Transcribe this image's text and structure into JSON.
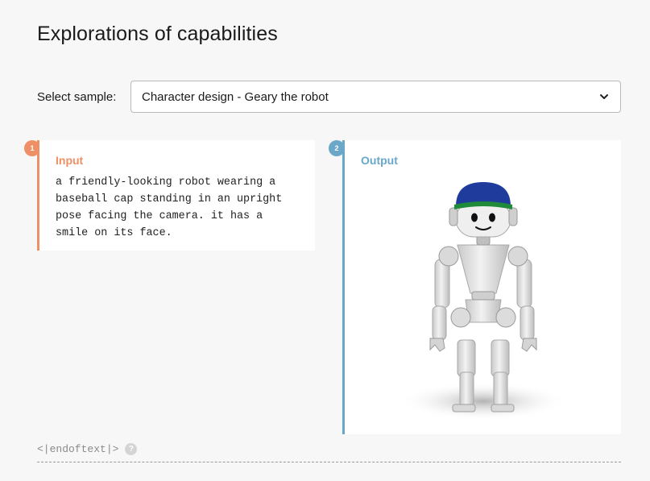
{
  "page": {
    "title": "Explorations of capabilities"
  },
  "sample_select": {
    "label": "Select sample:",
    "selected": "Character design - Geary the robot"
  },
  "input_panel": {
    "number": "1",
    "heading": "Input",
    "text": "a friendly-looking robot wearing a\nbaseball cap standing in an upright\npose facing the camera. it has a\nsmile on its face.",
    "accent_color": "#ef8f66"
  },
  "output_panel": {
    "number": "2",
    "heading": "Output",
    "accent_color": "#6aa7c9",
    "image": "robot-with-blue-baseball-cap"
  },
  "footer": {
    "end_token": "<|endoftext|>",
    "help_label": "?"
  },
  "icons": {
    "select_arrow": "chevron-down-icon",
    "help": "question-mark-icon"
  }
}
